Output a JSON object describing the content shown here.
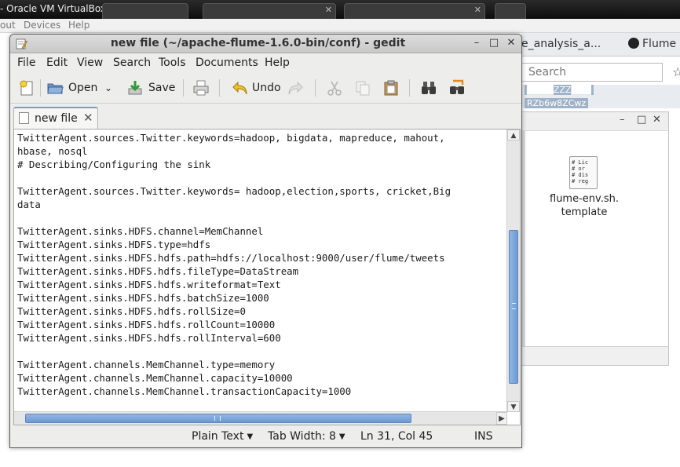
{
  "host": {
    "vbox_title": "- Oracle VM VirtualBox",
    "menu": [
      "out",
      "Devices",
      "Help"
    ]
  },
  "browser": {
    "tabs": [
      "e_analysis_a...",
      "Flume"
    ],
    "search_placeholder": "Search",
    "blurred_text": [
      "████ZZZ███",
      "RZb6w8ZCwz"
    ]
  },
  "file_window": {
    "icon_lines": [
      "# Lic",
      "# or",
      "# dis",
      "# reg"
    ],
    "file_name": "flume-env.sh.\ntemplate"
  },
  "gedit": {
    "title": "new file (~/apache-flume-1.6.0-bin/conf) - gedit",
    "menu": [
      "File",
      "Edit",
      "View",
      "Search",
      "Tools",
      "Documents",
      "Help"
    ],
    "toolbar": {
      "open_label": "Open",
      "save_label": "Save",
      "undo_label": "Undo"
    },
    "tab_label": "new file",
    "lines": [
      "TwitterAgent.sources.Twitter.keywords=hadoop, bigdata, mapreduce, mahout,",
      "hbase, nosql",
      "# Describing/Configuring the sink",
      "",
      "TwitterAgent.sources.Twitter.keywords= hadoop,election,sports, cricket,Big",
      "data",
      "",
      "TwitterAgent.sinks.HDFS.channel=MemChannel",
      "TwitterAgent.sinks.HDFS.type=hdfs",
      "TwitterAgent.sinks.HDFS.hdfs.path=hdfs://localhost:9000/user/flume/tweets",
      "TwitterAgent.sinks.HDFS.hdfs.fileType=DataStream",
      "TwitterAgent.sinks.HDFS.hdfs.writeformat=Text",
      "TwitterAgent.sinks.HDFS.hdfs.batchSize=1000",
      "TwitterAgent.sinks.HDFS.hdfs.rollSize=0",
      "TwitterAgent.sinks.HDFS.hdfs.rollCount=10000",
      "TwitterAgent.sinks.HDFS.hdfs.rollInterval=600",
      "",
      "TwitterAgent.channels.MemChannel.type=memory",
      "TwitterAgent.channels.MemChannel.capacity=10000",
      "TwitterAgent.channels.MemChannel.transactionCapacity=1000"
    ],
    "status": {
      "language": "Plain Text",
      "tab_width": "Tab Width:  8",
      "position": "Ln 31, Col 45",
      "mode": "INS"
    }
  }
}
